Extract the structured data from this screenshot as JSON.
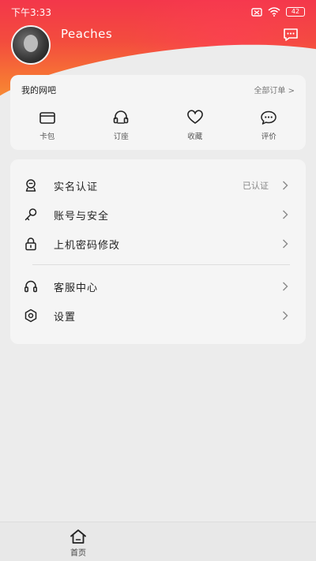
{
  "status_bar": {
    "time": "下午3:33",
    "battery": "42"
  },
  "profile": {
    "username": "Peaches"
  },
  "wangba_card": {
    "title": "我的网吧",
    "all_orders": "全部订单 >",
    "items": [
      {
        "label": "卡包",
        "icon": "card-wallet-icon"
      },
      {
        "label": "订座",
        "icon": "headset-icon"
      },
      {
        "label": "收藏",
        "icon": "heart-icon"
      },
      {
        "label": "评价",
        "icon": "comment-icon"
      }
    ]
  },
  "menu": {
    "items": [
      {
        "label": "实名认证",
        "status": "已认证",
        "icon": "user-verify-icon"
      },
      {
        "label": "账号与安全",
        "status": "",
        "icon": "key-icon"
      },
      {
        "label": "上机密码修改",
        "status": "",
        "icon": "lock-icon"
      },
      {
        "label": "客服中心",
        "status": "",
        "icon": "headphones-icon"
      },
      {
        "label": "设置",
        "status": "",
        "icon": "settings-hex-icon"
      }
    ]
  },
  "bottom_nav": {
    "home_label": "首页"
  },
  "colors": {
    "header_top": "#f3374a",
    "header_bottom": "#f7a23a",
    "background": "#ececec",
    "card": "#f5f5f5"
  }
}
